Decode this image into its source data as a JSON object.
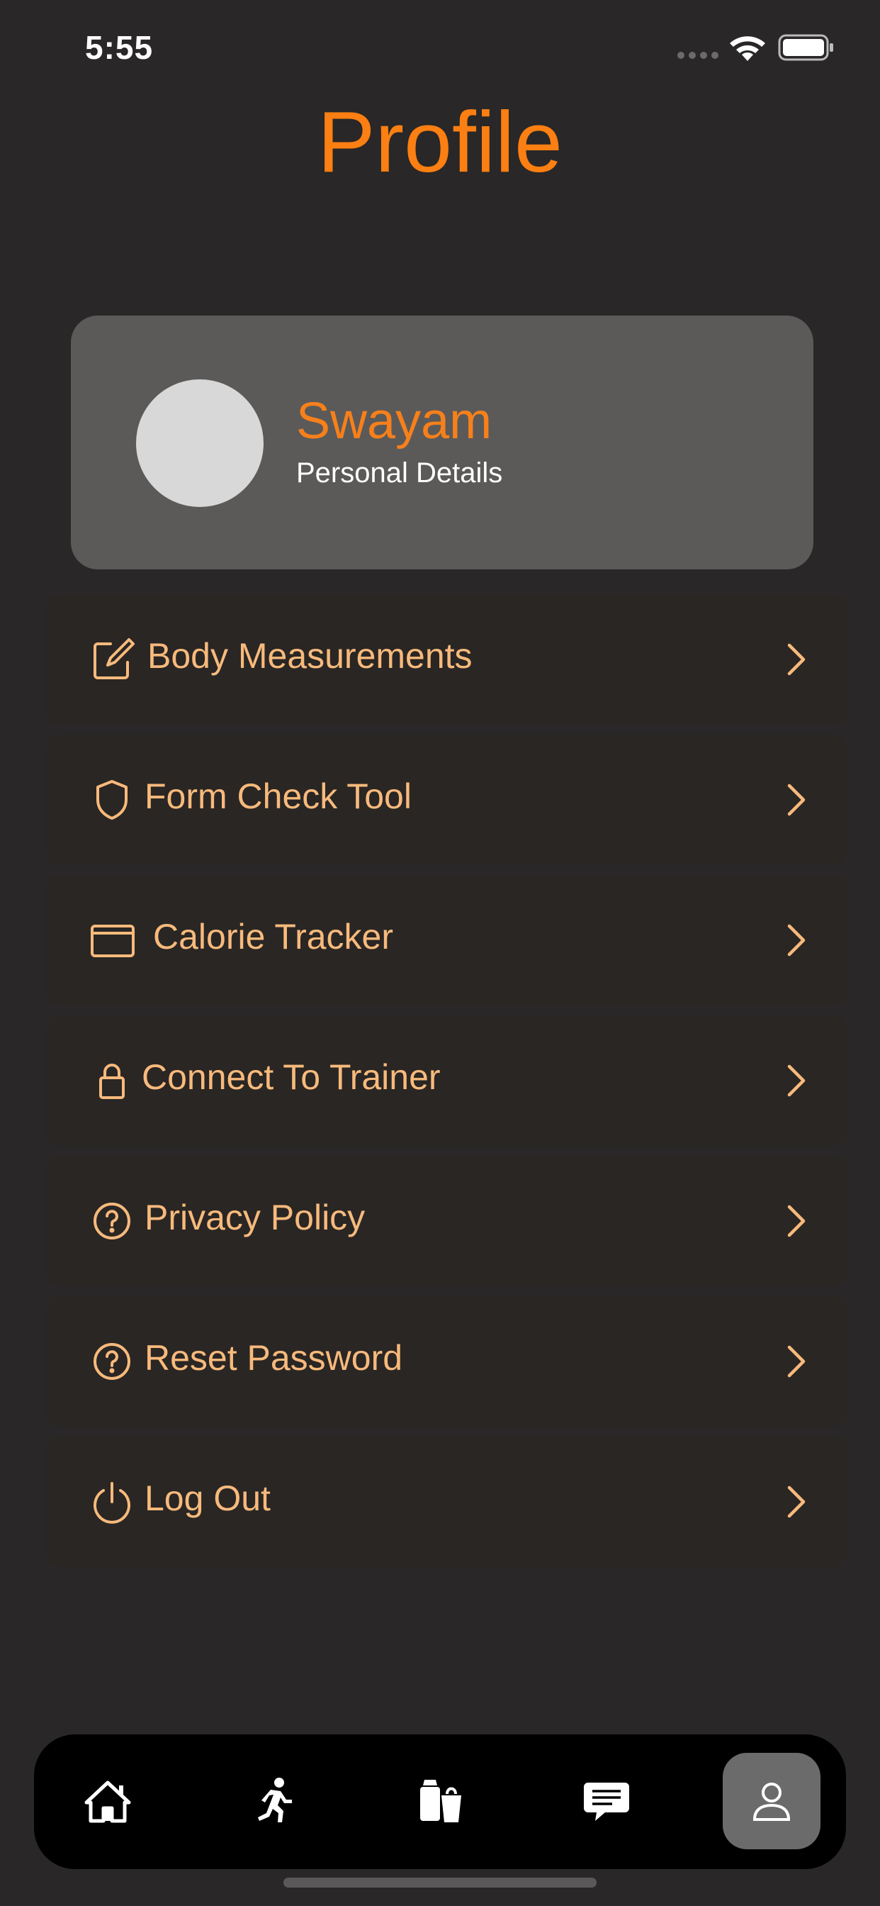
{
  "status": {
    "time": "5:55"
  },
  "page": {
    "title": "Profile"
  },
  "profile": {
    "name": "Swayam",
    "subtitle": "Personal Details"
  },
  "menu": [
    {
      "label": "Body Measurements",
      "icon": "edit-square-icon"
    },
    {
      "label": "Form Check Tool",
      "icon": "shield-icon"
    },
    {
      "label": "Calorie Tracker",
      "icon": "card-icon"
    },
    {
      "label": "Connect To Trainer",
      "icon": "lock-icon"
    },
    {
      "label": "Privacy Policy",
      "icon": "help-circle-icon"
    },
    {
      "label": "Reset Password",
      "icon": "help-circle-icon"
    },
    {
      "label": "Log Out",
      "icon": "power-icon"
    }
  ],
  "tabs": [
    {
      "icon": "home-icon"
    },
    {
      "icon": "running-icon"
    },
    {
      "icon": "grocery-bag-icon"
    },
    {
      "icon": "chat-bubble-icon"
    },
    {
      "icon": "person-icon",
      "active": true
    }
  ],
  "colors": {
    "accent": "#fb7f12",
    "menu_text": "#f7ba7c",
    "card": "#5b5a59",
    "background": "#292727"
  }
}
